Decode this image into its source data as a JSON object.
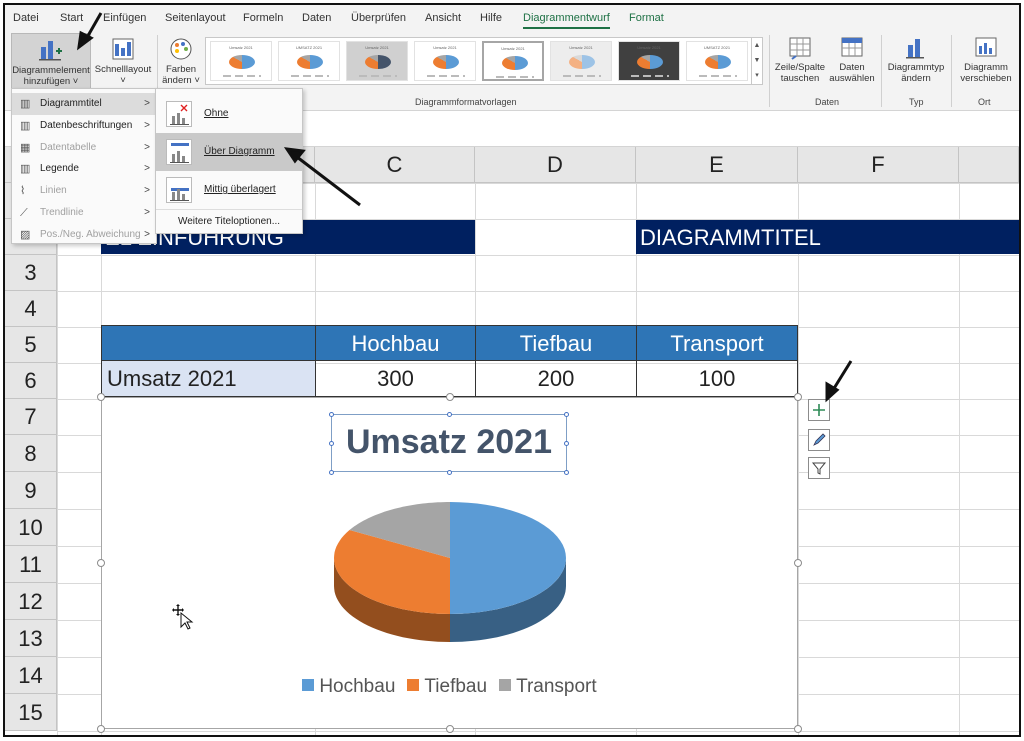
{
  "tabs": [
    "Datei",
    "Start",
    "Einfügen",
    "Seitenlayout",
    "Formeln",
    "Daten",
    "Überprüfen",
    "Ansicht",
    "Hilfe",
    "Diagrammentwurf",
    "Format"
  ],
  "ribbon": {
    "add_element": [
      "Diagrammelement",
      "hinzufügen ˅"
    ],
    "quick_layout": [
      "Schnelllayout",
      "˅"
    ],
    "colors": [
      "Farben",
      "ändern ˅"
    ],
    "styles_group": "Diagrammformatvorlagen",
    "switch_row_col": [
      "Zeile/Spalte",
      "tauschen"
    ],
    "select_data": [
      "Daten",
      "auswählen"
    ],
    "data_group": "Daten",
    "change_type": [
      "Diagrammtyp",
      "ändern"
    ],
    "type_group": "Typ",
    "move_chart": [
      "Diagramm",
      "verschieben"
    ],
    "location_group": "Ort",
    "thumb_titles": [
      "Umsatz 2021",
      "UMSATZ 2021",
      "Umsatz 2021",
      "Umsatz 2021",
      "Umsatz 2021",
      "Umsatz 2021",
      "Umsatz 2021",
      "UMSATZ 2021"
    ]
  },
  "menu_primary": [
    {
      "label": "Diagrammtitel",
      "arrow": ">",
      "disabled": false,
      "hover": true
    },
    {
      "label": "Datenbeschriftungen",
      "arrow": ">",
      "disabled": false
    },
    {
      "label": "Datentabelle",
      "arrow": ">",
      "disabled": true
    },
    {
      "label": "Legende",
      "arrow": ">",
      "disabled": false
    },
    {
      "label": "Linien",
      "arrow": ">",
      "disabled": true
    },
    {
      "label": "Trendlinie",
      "arrow": ">",
      "disabled": true
    },
    {
      "label": "Pos./Neg. Abweichung",
      "arrow": ">",
      "disabled": true
    }
  ],
  "menu_title": {
    "options": [
      "Ohne",
      "Über Diagramm",
      "Mittig überlagert"
    ],
    "more": "Weitere Titeloptionen..."
  },
  "columns": [
    "C",
    "D",
    "E",
    "F"
  ],
  "rows": [
    "3",
    "4",
    "5",
    "6",
    "7",
    "8",
    "9",
    "10",
    "11",
    "12",
    "13",
    "14",
    "15"
  ],
  "sheet": {
    "banner_left": "EL EINFÜHRUNG",
    "banner_right": "DIAGRAMMTITEL",
    "table_headers": [
      "Hochbau",
      "Tiefbau",
      "Transport"
    ],
    "row_label": "Umsatz 2021",
    "row_values": [
      "300",
      "200",
      "100"
    ]
  },
  "chart_data": {
    "type": "pie",
    "title": "Umsatz 2021",
    "categories": [
      "Hochbau",
      "Tiefbau",
      "Transport"
    ],
    "values": [
      300,
      200,
      100
    ],
    "colors": [
      "#5b9bd5",
      "#ed7d31",
      "#a5a5a5"
    ],
    "legend": "bottom",
    "style": "3d"
  },
  "chart_side_buttons": [
    "plus-icon",
    "brush-icon",
    "filter-icon"
  ]
}
